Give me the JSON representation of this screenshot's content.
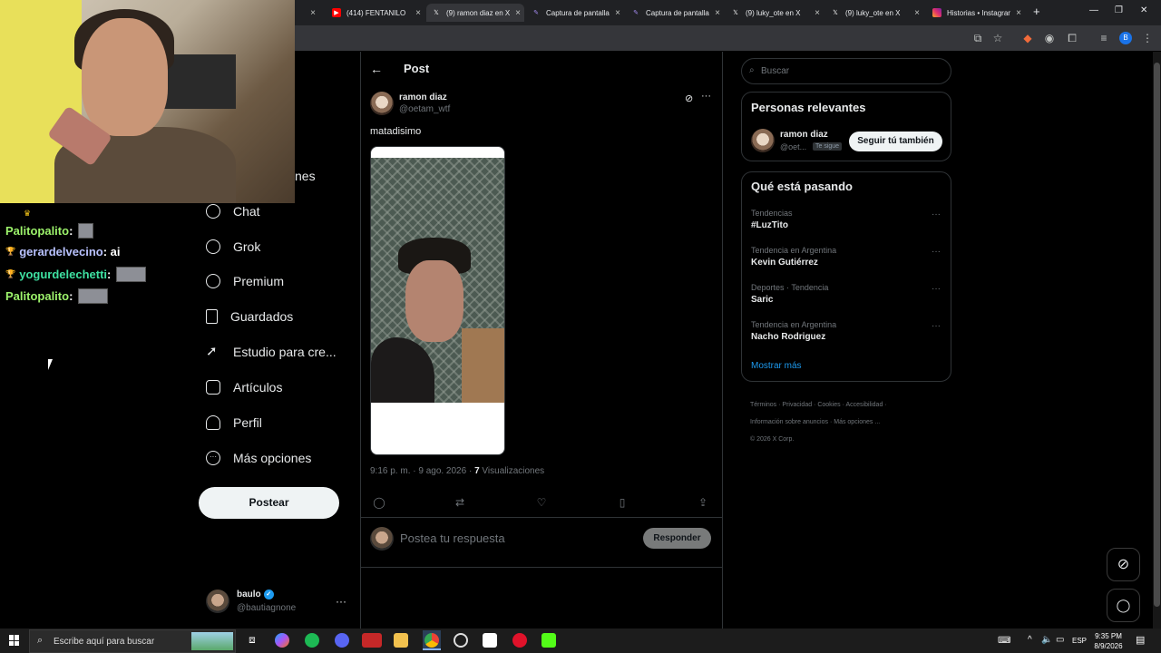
{
  "browser": {
    "tabs": [
      {
        "label": "(414) FENTANILO",
        "icon": "youtube-icon",
        "color": "#ff0000"
      },
      {
        "label": "(9) ramon diaz en X",
        "icon": "x-logo-icon",
        "color": "#ffffff",
        "active": true
      },
      {
        "label": "Captura de pantalla",
        "icon": "feather-icon",
        "color": "#a48bf0"
      },
      {
        "label": "Captura de pantalla",
        "icon": "feather-icon",
        "color": "#a48bf0"
      },
      {
        "label": "(9) luky_ote en X",
        "icon": "x-logo-icon",
        "color": "#ffffff"
      },
      {
        "label": "(9) luky_ote en X",
        "icon": "x-logo-icon",
        "color": "#ffffff"
      },
      {
        "label": "Historias • Instagram",
        "icon": "instagram-icon",
        "color": "#e1306c"
      }
    ],
    "profile_initial": "B"
  },
  "stream_chat": [
    {
      "user": "Palitopalito",
      "sep": " :",
      "message": "",
      "color": "#9cf26b",
      "has_image": true
    },
    {
      "user": "gerardelvecino",
      "sep": " :",
      "message": " ai",
      "color": "#b9c2ff",
      "has_image": false
    },
    {
      "user": "yogurdelechetti",
      "sep": " :",
      "message": "",
      "color": "#3ee0a1",
      "has_image": true
    },
    {
      "user": "Palitopalito",
      "sep": " :",
      "message": "",
      "color": "#9cf26b",
      "has_image": true
    }
  ],
  "nav": {
    "partial_label": "nes",
    "items": [
      {
        "label": "Chat",
        "icon": "chat-icon"
      },
      {
        "label": "Grok",
        "icon": "grok-icon"
      },
      {
        "label": "Premium",
        "icon": "premium-icon"
      },
      {
        "label": "Guardados",
        "icon": "bookmark-icon"
      },
      {
        "label": "Estudio para cre...",
        "icon": "rocket-icon"
      },
      {
        "label": "Artículos",
        "icon": "article-icon"
      },
      {
        "label": "Perfil",
        "icon": "profile-icon"
      },
      {
        "label": "Más opciones",
        "icon": "more-options-icon"
      }
    ],
    "post_button": "Postear",
    "account": {
      "name": "baulo",
      "handle": "@bautiagnone",
      "verified": true
    }
  },
  "post": {
    "header": "Post",
    "author_name": "ramon diaz",
    "author_handle": "@oetam_wtf",
    "text": "matadisimo",
    "time": "9:16 p. m. · 9 ago. 2026 ·",
    "views_count": "7",
    "views_label": "Visualizaciones",
    "reply_placeholder": "Postea tu respuesta",
    "reply_button": "Responder"
  },
  "sidebar": {
    "search_placeholder": "Buscar",
    "relevant_title": "Personas relevantes",
    "relevant_name": "ramon diaz",
    "relevant_handle": "@oet...",
    "follows_you": "Te sigue",
    "follow_back_button": "Seguir tú también",
    "trending_title": "Qué está pasando",
    "trends": [
      {
        "context": "Tendencias",
        "title": "#LuzTito"
      },
      {
        "context": "Tendencia en Argentina",
        "title": "Kevin Gutiérrez"
      },
      {
        "context": "Deportes · Tendencia",
        "title": "Saric"
      },
      {
        "context": "Tendencia en Argentina",
        "title": "Nacho Rodriguez"
      }
    ],
    "show_more": "Mostrar más",
    "footer_links": [
      "Términos",
      "Privacidad",
      "Cookies",
      "Accesibilidad",
      "Información sobre anuncios",
      "Más opciones ..."
    ],
    "copyright": "© 2026 X Corp."
  },
  "taskbar": {
    "search_placeholder": "Escribe aquí para buscar",
    "language": "ESP",
    "time": "9:35 PM",
    "date": "8/9/2026"
  }
}
